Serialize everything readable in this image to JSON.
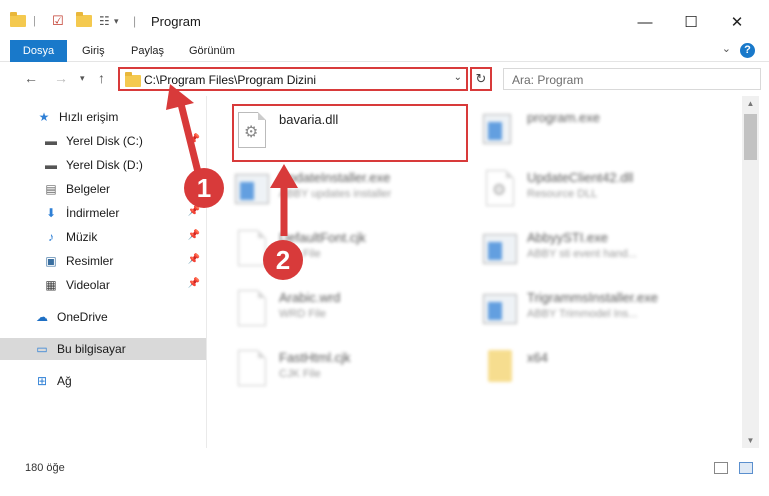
{
  "window": {
    "title": "Program",
    "minimize": "—",
    "maximize": "☐",
    "close": "✕"
  },
  "ribbon": {
    "tabs": [
      "Dosya",
      "Giriş",
      "Paylaş",
      "Görünüm"
    ],
    "help": "?"
  },
  "address": {
    "path": "C:\\Program Files\\Program Dizini",
    "search_placeholder": "Ara: Program"
  },
  "sidebar": {
    "items": [
      {
        "label": "Hızlı erişim",
        "icon": "star-icon"
      },
      {
        "label": "Yerel Disk (C:)",
        "icon": "drive-icon"
      },
      {
        "label": "Yerel Disk (D:)",
        "icon": "drive-icon"
      },
      {
        "label": "Belgeler",
        "icon": "documents-icon"
      },
      {
        "label": "İndirmeler",
        "icon": "download-icon"
      },
      {
        "label": "Müzik",
        "icon": "music-icon"
      },
      {
        "label": "Resimler",
        "icon": "pictures-icon"
      },
      {
        "label": "Videolar",
        "icon": "video-icon"
      },
      {
        "label": "OneDrive",
        "icon": "cloud-icon"
      },
      {
        "label": "Bu bilgisayar",
        "icon": "computer-icon"
      },
      {
        "label": "Ağ",
        "icon": "network-icon"
      }
    ]
  },
  "files": [
    {
      "name": "bavaria.dll",
      "sub": ""
    },
    {
      "name": "program.exe",
      "sub": ""
    },
    {
      "name": "UpdateInstaller.exe",
      "sub": "ABBY updates installer"
    },
    {
      "name": "UpdateClient42.dll",
      "sub": "Resource DLL"
    },
    {
      "name": "DefaultFont.cjk",
      "sub": "CJK File"
    },
    {
      "name": "AbbyySTI.exe",
      "sub": "ABBY sti event hand..."
    },
    {
      "name": "Arabic.wrd",
      "sub": "WRD File"
    },
    {
      "name": "TrigrammsInstaller.exe",
      "sub": "ABBY Trimmodel Ins..."
    },
    {
      "name": "FastHtml.cjk",
      "sub": "CJK File"
    },
    {
      "name": "x64",
      "sub": ""
    }
  ],
  "annotations": [
    "1",
    "2"
  ],
  "status": {
    "count": "180 öğe"
  }
}
